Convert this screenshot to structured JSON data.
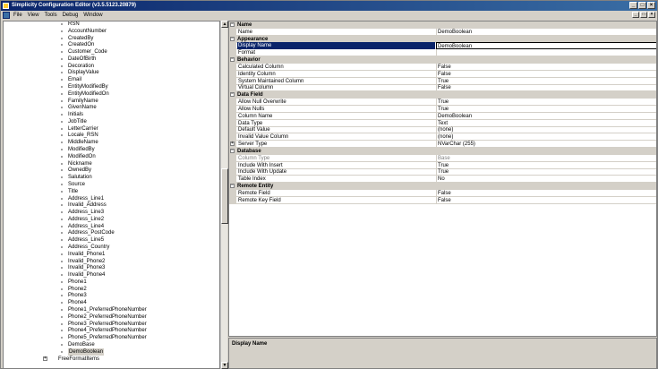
{
  "window": {
    "title": "Simplicity Configuration Editor (v3.5.5123.20879)",
    "minimize": "_",
    "maximize": "□",
    "close": "×"
  },
  "menu": [
    "File",
    "View",
    "Tools",
    "Debug",
    "Window"
  ],
  "tree": {
    "items": [
      "RSN",
      "AccountNumber",
      "CreatedBy",
      "CreatedOn",
      "Customer_Code",
      "DateOfBirth",
      "Decoration",
      "DisplayValue",
      "Email",
      "EntityModifiedBy",
      "EntityModifiedOn",
      "FamilyName",
      "GivenName",
      "Initials",
      "JobTitle",
      "LetterCarrier",
      "Locale_RSN",
      "MiddleName",
      "ModifiedBy",
      "ModifiedOn",
      "Nickname",
      "OwnedBy",
      "Salutation",
      "Source",
      "Title",
      "Address_Line1",
      "Invalid_Address",
      "Address_Line3",
      "Address_Line2",
      "Address_Line4",
      "Address_PostCode",
      "Address_Line5",
      "Address_Country",
      "Invalid_Phone1",
      "Invalid_Phone2",
      "Invalid_Phone3",
      "Invalid_Phone4",
      "Phone1",
      "Phone2",
      "Phone3",
      "Phone4",
      "Phone1_PreferredPhoneNumber",
      "Phone2_PreferredPhoneNumber",
      "Phone3_PreferredPhoneNumber",
      "Phone4_PreferredPhoneNumber",
      "Phone5_PreferredPhoneNumber",
      "DemoBase",
      "DemoBoolean"
    ],
    "selected": "DemoBoolean",
    "next_item": "FreeFormatItems"
  },
  "properties": {
    "rows": [
      {
        "type": "cat",
        "name": "Name"
      },
      {
        "type": "prop",
        "name": "Name",
        "value": "DemoBoolean"
      },
      {
        "type": "cat",
        "name": "Appearance"
      },
      {
        "type": "prop",
        "name": "Display Name",
        "value": "DemoBoolean",
        "selected": true
      },
      {
        "type": "prop",
        "name": "Format",
        "value": ""
      },
      {
        "type": "cat",
        "name": "Behavior"
      },
      {
        "type": "prop",
        "name": "Calculated Column",
        "value": "False"
      },
      {
        "type": "prop",
        "name": "Identity Column",
        "value": "False"
      },
      {
        "type": "prop",
        "name": "System Maintained Column",
        "value": "True"
      },
      {
        "type": "prop",
        "name": "Virtual Column",
        "value": "False"
      },
      {
        "type": "cat",
        "name": "Data Field"
      },
      {
        "type": "prop",
        "name": "Allow Null Overwrite",
        "value": "True"
      },
      {
        "type": "prop",
        "name": "Allow Nulls",
        "value": "True"
      },
      {
        "type": "prop",
        "name": "Column Name",
        "value": "DemoBoolean"
      },
      {
        "type": "prop",
        "name": "Data Type",
        "value": "Text"
      },
      {
        "type": "prop",
        "name": "Default Value",
        "value": "(none)"
      },
      {
        "type": "prop",
        "name": "Invalid Value Column",
        "value": "(none)"
      },
      {
        "type": "prop",
        "name": "Server Type",
        "value": "NVarChar (255)",
        "expandable": true
      },
      {
        "type": "cat",
        "name": "Database"
      },
      {
        "type": "prop",
        "name": "Column Type",
        "value": "Base",
        "disabled": true
      },
      {
        "type": "prop",
        "name": "Include With Insert",
        "value": "True"
      },
      {
        "type": "prop",
        "name": "Include With Update",
        "value": "True"
      },
      {
        "type": "prop",
        "name": "Table Index",
        "value": "No"
      },
      {
        "type": "cat",
        "name": "Remote Entity"
      },
      {
        "type": "prop",
        "name": "Remote Field",
        "value": "False"
      },
      {
        "type": "prop",
        "name": "Remote Key Field",
        "value": "False"
      }
    ]
  },
  "description": {
    "title": "Display Name"
  }
}
